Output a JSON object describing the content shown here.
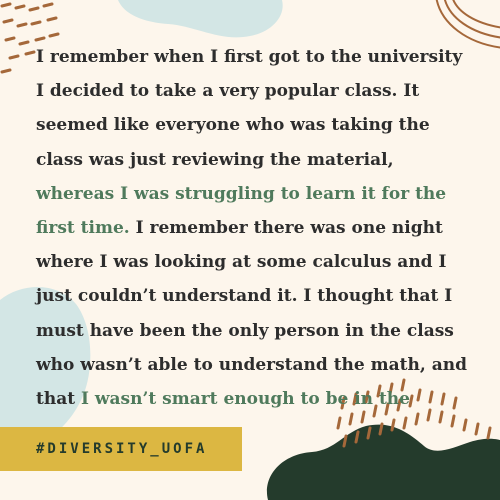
{
  "quote": {
    "part1": "I remember when I first got to the university I decided to take a very popular class. It seemed like everyone who was taking the class was just reviewing the material, ",
    "highlight1": "whereas I was struggling to learn it for the first time.",
    "part2": " I remember there was one night where I was looking at some calculus and I just couldn’t understand it. I thought that I must have been the only person in the class who wasn’t able to understand the math, and that ",
    "highlight2": "I wasn’t smart enough to be in the course."
  },
  "hashtag": "#DIVERSITY_UOFA",
  "colors": {
    "background": "#fdf6ec",
    "blob_blue": "#d3e6e5",
    "dark_blob": "#243b2c",
    "accent_brown": "#a5683a",
    "highlight_green": "#4f7a5c",
    "hashtag_bar": "#dcb742"
  }
}
